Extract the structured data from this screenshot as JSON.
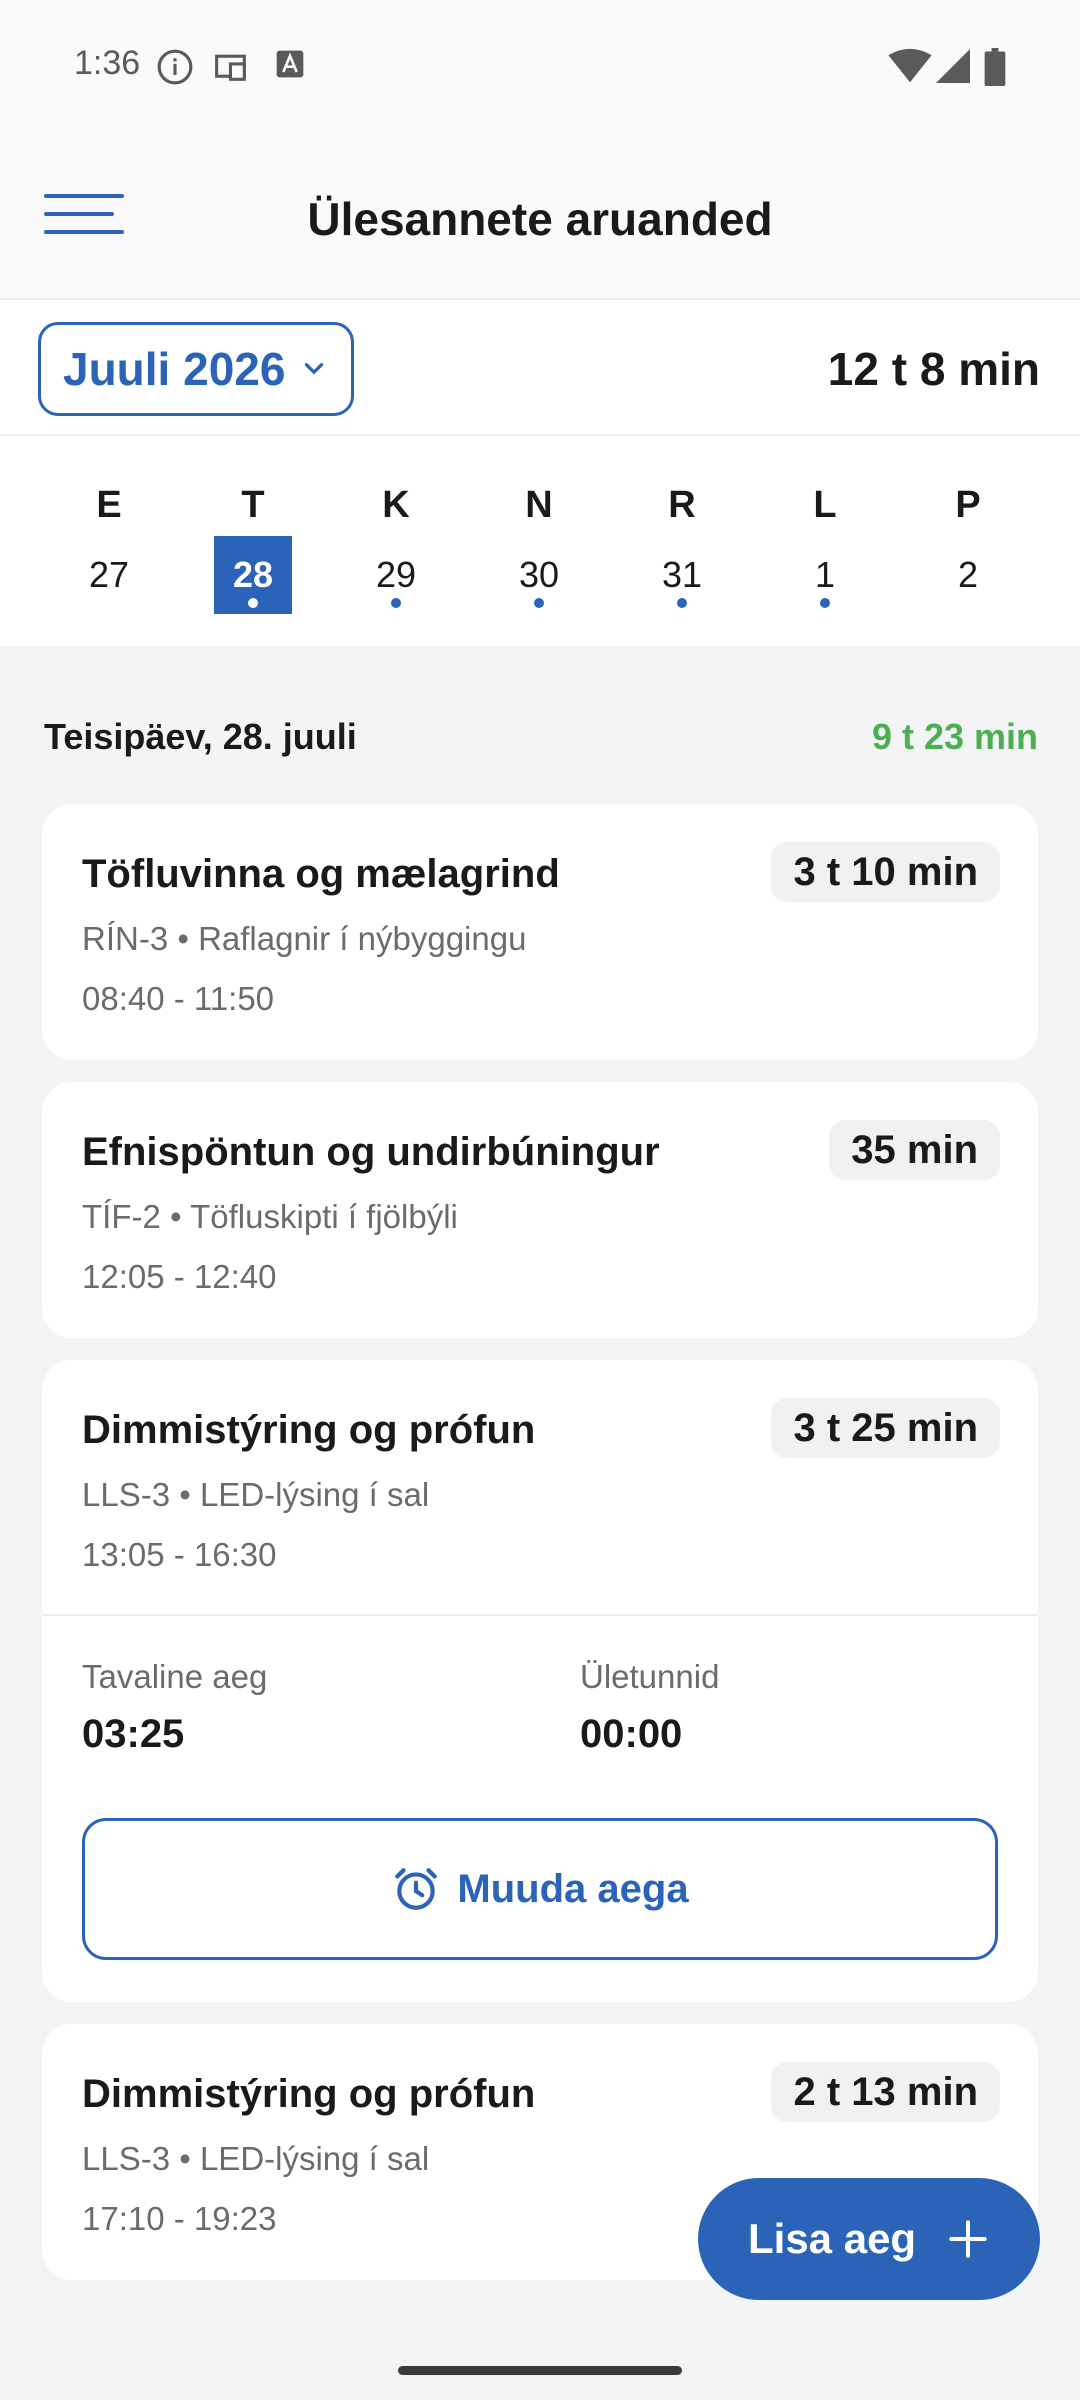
{
  "status_bar": {
    "time": "1:36",
    "icons": [
      "info-icon",
      "cast-device-icon",
      "font-a-icon",
      "wifi-icon",
      "signal-icon",
      "battery-icon"
    ]
  },
  "app_bar": {
    "title": "Ülesannete aruanded",
    "menu_icon": "menu-icon"
  },
  "month_bar": {
    "month_label": "Juuli 2026",
    "total": "12 t 8 min"
  },
  "week": [
    {
      "letter": "E",
      "num": "27",
      "selected": false,
      "has_entries": false
    },
    {
      "letter": "T",
      "num": "28",
      "selected": true,
      "has_entries": true
    },
    {
      "letter": "K",
      "num": "29",
      "selected": false,
      "has_entries": true
    },
    {
      "letter": "N",
      "num": "30",
      "selected": false,
      "has_entries": true
    },
    {
      "letter": "R",
      "num": "31",
      "selected": false,
      "has_entries": true
    },
    {
      "letter": "L",
      "num": "1",
      "selected": false,
      "has_entries": true
    },
    {
      "letter": "P",
      "num": "2",
      "selected": false,
      "has_entries": false
    }
  ],
  "day_summary": {
    "date_label": "Teisipäev, 28. juuli",
    "total": "9 t 23 min"
  },
  "entries": [
    {
      "title": "Töfluvinna og mælagrind",
      "duration": "3 t 10 min",
      "subtitle": "RÍN-3 • Raflagnir í nýbyggingu",
      "time_range": "08:40 - 11:50"
    },
    {
      "title": "Efnispöntun og undirbúningur",
      "duration": "35 min",
      "subtitle": "TÍF-2 • Töfluskipti í fjölbýli",
      "time_range": "12:05 - 12:40"
    },
    {
      "title": "Dimmistýring og prófun",
      "duration": "3 t 25 min",
      "subtitle": "LLS-3 • LED-lýsing í sal",
      "time_range": "13:05 - 16:30",
      "regular_label": "Tavaline aeg",
      "regular_value": "03:25",
      "overtime_label": "Ületunnid",
      "overtime_value": "00:00",
      "edit_label": "Muuda aega"
    },
    {
      "title": "Dimmistýring og prófun",
      "duration": "2 t 13 min",
      "subtitle": "LLS-3 • LED-lýsing í sal",
      "time_range": "17:10 - 19:23"
    }
  ],
  "fab": {
    "label": "Lisa aeg",
    "icon": "plus-icon"
  },
  "colors": {
    "accent": "#2a63b8",
    "positive": "#4caf50",
    "background": "#f3f4f6"
  }
}
